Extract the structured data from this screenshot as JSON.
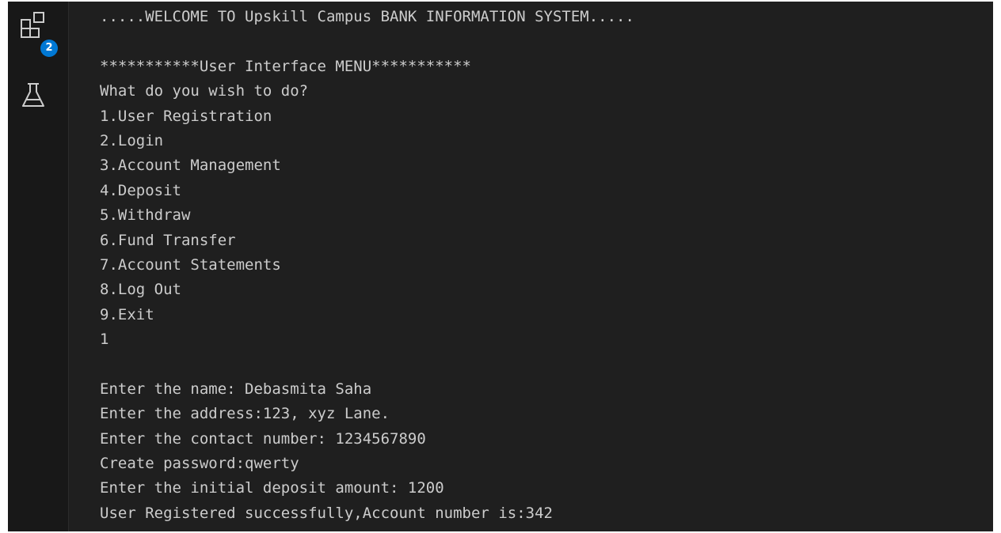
{
  "activity_bar": {
    "items": [
      {
        "icon": "extensions-icon",
        "badge": "2"
      },
      {
        "icon": "flask-icon"
      }
    ]
  },
  "colors": {
    "background": "#1f1f1f",
    "activity_bar": "#181818",
    "text": "#cccccc",
    "badge": "#0078d4"
  },
  "terminal": {
    "lines": [
      ".....WELCOME TO Upskill Campus BANK INFORMATION SYSTEM.....",
      "",
      "***********User Interface MENU***********",
      "What do you wish to do?",
      "1.User Registration",
      "2.Login",
      "3.Account Management",
      "4.Deposit",
      "5.Withdraw",
      "6.Fund Transfer",
      "7.Account Statements",
      "8.Log Out",
      "9.Exit",
      "1",
      "",
      "Enter the name: Debasmita Saha",
      "Enter the address:123, xyz Lane.",
      "Enter the contact number: 1234567890",
      "Create password:qwerty",
      "Enter the initial deposit amount: 1200",
      "User Registered successfully,Account number is:342"
    ]
  }
}
